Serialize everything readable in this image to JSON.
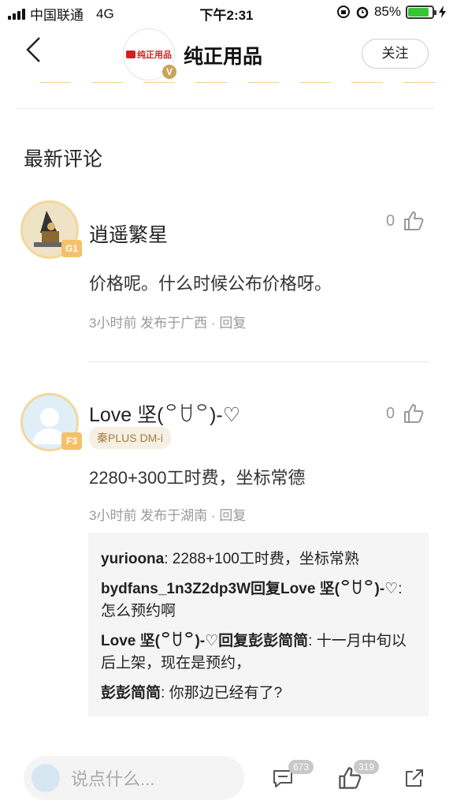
{
  "status_bar": {
    "carrier": "中国联通",
    "network": "4G",
    "time": "下午2:31",
    "battery_percent": "85%",
    "battery_level": 0.85
  },
  "header": {
    "brand_logo_text": "纯正用品",
    "brand_name": "纯正用品",
    "verified_badge": "V",
    "follow_label": "关注"
  },
  "section_title": "最新评论",
  "comments": [
    {
      "username": "逍遥繁星",
      "level": "G1",
      "likes": "0",
      "text": "价格呢。什么时候公布价格呀。",
      "meta": "3小时前 发布于广西",
      "separator": "·",
      "reply_label": "回复"
    },
    {
      "username": "Love 坚(꒪ꇴ꒪)-♡",
      "level": "F3",
      "tag": "秦PLUS DM-i",
      "likes": "0",
      "text": "2280+300工时费，坐标常德",
      "meta": "3小时前 发布于湖南",
      "separator": "·",
      "reply_label": "回复",
      "replies": [
        {
          "author": "yurioona",
          "sep": ": ",
          "text": "2288+100工时费，坐标常熟"
        },
        {
          "author": "bydfans_1n3Z2dp3W回复Love 坚(꒪ꇴ꒪)-♡",
          "sep": ": ",
          "text": "怎么预约啊"
        },
        {
          "author": "Love 坚(꒪ꇴ꒪)-♡回复彭彭简简",
          "sep": ": ",
          "text": "十一月中旬以后上架，现在是预约，"
        },
        {
          "author": "彭彭简简",
          "sep": ": ",
          "text": "你那边已经有了?"
        }
      ]
    }
  ],
  "bottom_bar": {
    "input_placeholder": "说点什么...",
    "comment_count": "673",
    "like_count": "319"
  },
  "icons": [
    "back-icon",
    "alarm-icon",
    "lock-rotation-icon",
    "charging-icon",
    "thumbs-up-icon",
    "comment-icon",
    "share-icon"
  ],
  "colors": {
    "accent_gold": "#f3d79b",
    "level_badge": "#f5c068",
    "battery_green": "#37c437",
    "brand_red": "#d42020"
  }
}
